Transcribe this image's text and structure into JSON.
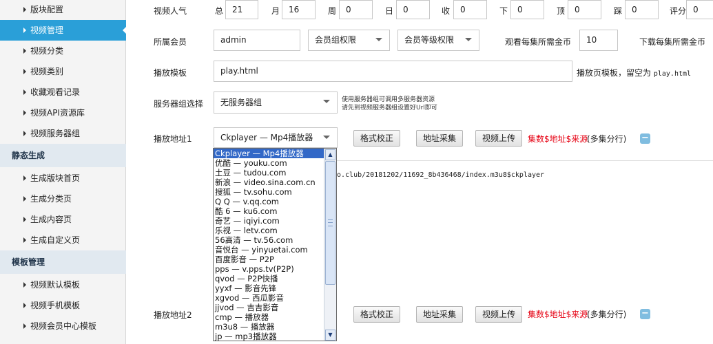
{
  "sidebar": {
    "items_top": [
      {
        "label": "版块配置"
      },
      {
        "label": "视频管理",
        "active": true
      },
      {
        "label": "视频分类"
      },
      {
        "label": "视频类别"
      },
      {
        "label": "收藏观看记录"
      },
      {
        "label": "视频API资源库"
      },
      {
        "label": "视频服务器组"
      }
    ],
    "section_static": "静态生成",
    "items_static": [
      {
        "label": "生成版块首页"
      },
      {
        "label": "生成分类页"
      },
      {
        "label": "生成内容页"
      },
      {
        "label": "生成自定义页"
      }
    ],
    "section_template": "模板管理",
    "items_template": [
      {
        "label": "视频默认模板"
      },
      {
        "label": "视频手机模板"
      },
      {
        "label": "视频会员中心模板"
      }
    ]
  },
  "popularity": {
    "label": "视频人气",
    "fields": [
      {
        "label": "总",
        "value": "21"
      },
      {
        "label": "月",
        "value": "16"
      },
      {
        "label": "周",
        "value": "0"
      },
      {
        "label": "日",
        "value": "0"
      },
      {
        "label": "收",
        "value": "0"
      },
      {
        "label": "下",
        "value": "0"
      },
      {
        "label": "顶",
        "value": "0"
      },
      {
        "label": "踩",
        "value": "0"
      },
      {
        "label": "评分",
        "value": "0"
      }
    ]
  },
  "member": {
    "label": "所属会员",
    "value": "admin",
    "group_select": "会员组权限",
    "level_select": "会员等级权限",
    "coin_label": "观看每集所需金币",
    "coin_value": "10",
    "download_label": "下载每集所需金币"
  },
  "template": {
    "label": "播放模板",
    "value": "play.html",
    "hint_prefix": "播放页模板，留空为",
    "hint_code": "play.html"
  },
  "server": {
    "label": "服务器组选择",
    "value": "无服务器组",
    "note_line1": "使用服务器组可调用多服务器资源",
    "note_line2": "请先到视频服务器组设置好Url即可"
  },
  "play1": {
    "label": "播放地址1",
    "player_value": "Ckplayer — Mp4播放器",
    "btn_format": "格式校正",
    "btn_collect": "地址采集",
    "btn_upload": "视频上传",
    "format_red": "集数$地址$来源",
    "format_note": "(多集分行)",
    "minus": "−",
    "url_text": "o.club/20181202/11692_8b436468/index.m3u8$ckplayer"
  },
  "play2": {
    "label": "播放地址2",
    "btn_format": "格式校正",
    "btn_collect": "地址采集",
    "btn_upload": "视频上传",
    "format_red": "集数$地址$来源",
    "format_note": "(多集分行)",
    "minus": "−"
  },
  "dropdown": {
    "options": [
      "Ckplayer — Mp4播放器",
      "优酷 — youku.com",
      "土豆 — tudou.com",
      "新浪 — video.sina.com.cn",
      "搜狐 — tv.sohu.com",
      "Q Q — v.qq.com",
      "酷 6 — ku6.com",
      "奇艺 — iqiyi.com",
      "乐视 — letv.com",
      "56高清 — tv.56.com",
      "音悦台 — yinyuetai.com",
      "百度影音 — P2P",
      "pps — v.pps.tv(P2P)",
      "qvod — P2P快播",
      "yyxf — 影音先锋",
      "xgvod — 西瓜影音",
      "jjvod — 吉吉影音",
      "cmp — 播放器",
      "m3u8 — 播放器",
      "jp — mp3播放器"
    ],
    "selected_index": 0
  },
  "colors": {
    "accent": "#2a9fd8",
    "selected_option": "#3268c7",
    "section_bg": "#e1e9f0",
    "red_text": "#e60012"
  }
}
